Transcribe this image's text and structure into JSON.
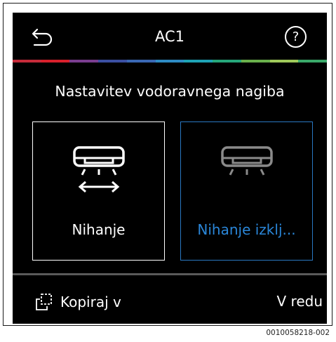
{
  "header": {
    "title": "AC1",
    "help_label": "?"
  },
  "color_strip": [
    "#c62b3a",
    "#d8202c",
    "#7a3d8f",
    "#3b4fa2",
    "#3a68b4",
    "#2e8bc4",
    "#1ea3b5",
    "#26a67a",
    "#6ab04c",
    "#9fc95a",
    "#3aa86a"
  ],
  "heading": "Nastavitev vodoravnega nagiba",
  "options": [
    {
      "label": "Nihanje",
      "selected": false,
      "icon": "ac-swing-icon"
    },
    {
      "label": "Nihanje izklj...",
      "selected": true,
      "icon": "ac-swing-off-icon"
    }
  ],
  "footer": {
    "copy_label": "Kopiraj v",
    "ok_label": "V redu"
  },
  "image_code": "0010058218-002"
}
